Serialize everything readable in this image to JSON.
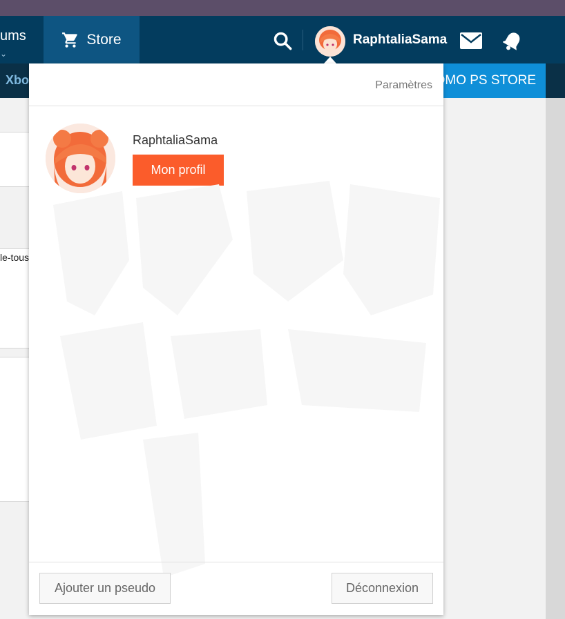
{
  "nav": {
    "forums_label": "ums",
    "store_label": "Store",
    "username": "RaphtaliaSama",
    "subnav_label": "Xbo",
    "promo_label": "OMO PS STORE"
  },
  "left": {
    "snippet": "le-tous"
  },
  "dropdown": {
    "settings_label": "Paramètres",
    "username": "RaphtaliaSama",
    "profile_button": "Mon profil",
    "add_pseudo_button": "Ajouter un pseudo",
    "logout_button": "Déconnexion"
  },
  "colors": {
    "navbar": "#033c5e",
    "store_tab": "#0e5582",
    "promo": "#0f8fd8",
    "profile_button": "#fb5c2b"
  },
  "icons": {
    "cart": "cart-icon",
    "search": "search-icon",
    "mail": "mail-icon",
    "bell": "bell-icon",
    "chevron": "chevron-down-icon"
  }
}
